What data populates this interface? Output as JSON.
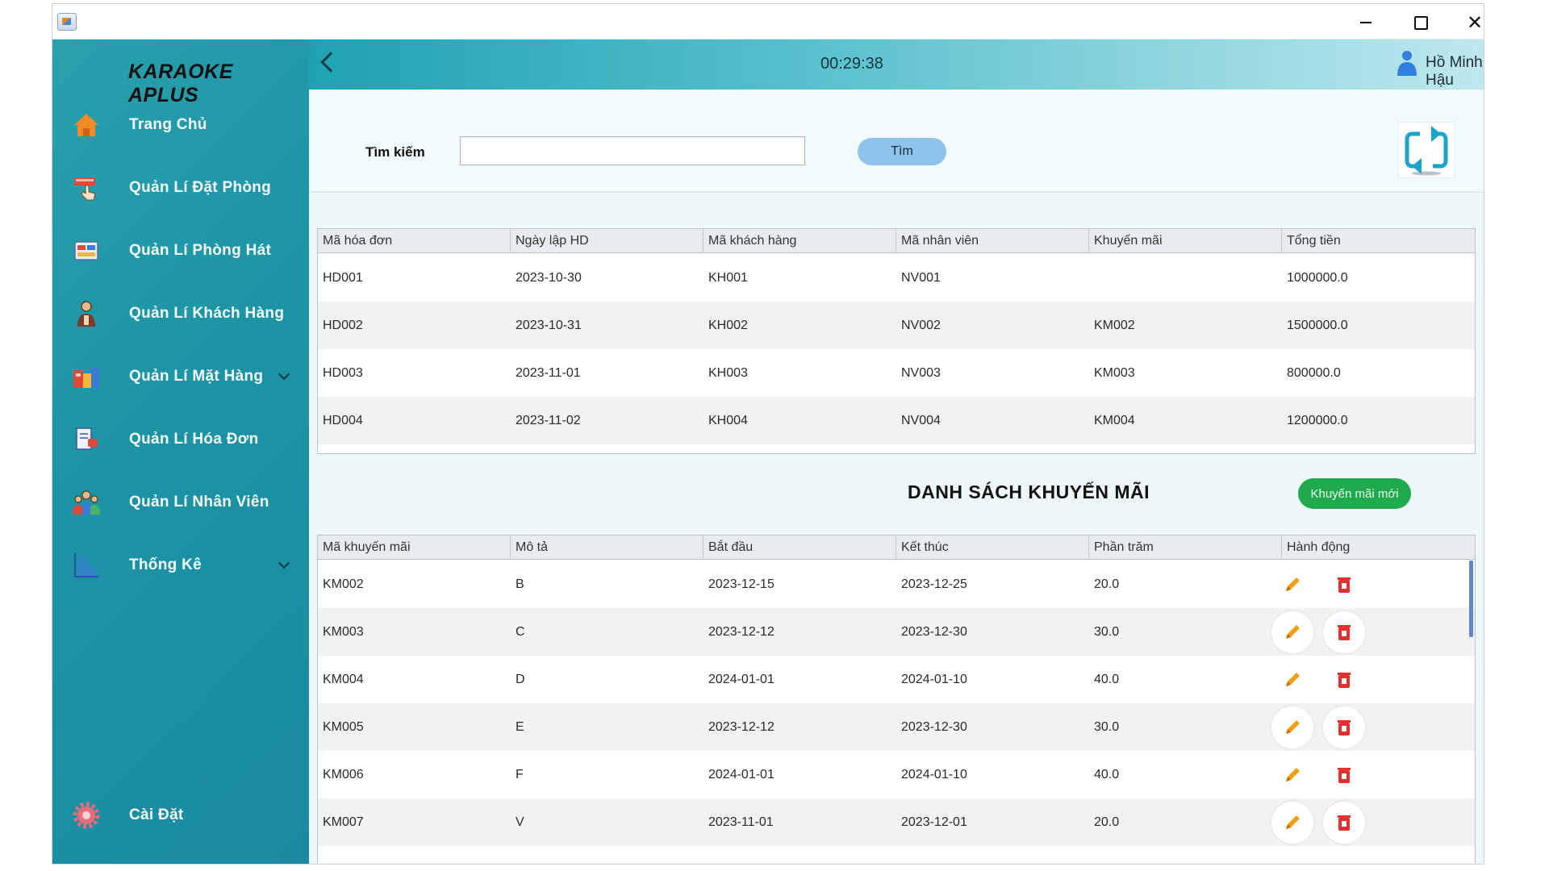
{
  "app": {
    "brand": "KARAOKE APLUS",
    "clock": "00:29:38",
    "user": "Hồ Minh Hậu"
  },
  "sidebar": {
    "items": [
      {
        "label": "Trang Chủ",
        "icon": "home-icon"
      },
      {
        "label": "Quản Lí Đặt Phòng",
        "icon": "booking-icon"
      },
      {
        "label": "Quản Lí Phòng Hát",
        "icon": "room-icon"
      },
      {
        "label": "Quản Lí Khách Hàng",
        "icon": "customer-icon"
      },
      {
        "label": "Quản Lí Mặt Hàng",
        "icon": "goods-icon"
      },
      {
        "label": "Quản Lí Hóa Đơn",
        "icon": "invoice-icon"
      },
      {
        "label": "Quản Lí Nhân Viên",
        "icon": "staff-icon"
      },
      {
        "label": "Thống Kê",
        "icon": "chart-icon"
      }
    ],
    "settings": {
      "label": "Cài Đặt",
      "icon": "settings-icon"
    }
  },
  "search": {
    "label": "Tìm kiếm",
    "value": "",
    "button": "Tìm"
  },
  "invoices": {
    "columns": [
      "Mã hóa đơn",
      "Ngày lập HD",
      "Mã khách hàng",
      "Mã nhân viên",
      "Khuyến mãi",
      "Tổng tiền"
    ],
    "rows": [
      [
        "HD001",
        "2023-10-30",
        "KH001",
        "NV001",
        "",
        "1000000.0"
      ],
      [
        "HD002",
        "2023-10-31",
        "KH002",
        "NV002",
        "KM002",
        "1500000.0"
      ],
      [
        "HD003",
        "2023-11-01",
        "KH003",
        "NV003",
        "KM003",
        "800000.0"
      ],
      [
        "HD004",
        "2023-11-02",
        "KH004",
        "NV004",
        "KM004",
        "1200000.0"
      ]
    ]
  },
  "promotions": {
    "title": "DANH SÁCH KHUYẾN MÃI",
    "new_button": "Khuyến mãi mới",
    "columns": [
      "Mã khuyến mãi",
      "Mô tả",
      "Bắt đầu",
      "Kết thúc",
      "Phần trăm",
      "Hành động"
    ],
    "rows": [
      [
        "KM002",
        "B",
        "2023-12-15",
        "2023-12-25",
        "20.0"
      ],
      [
        "KM003",
        "C",
        "2023-12-12",
        "2023-12-30",
        "30.0"
      ],
      [
        "KM004",
        "D",
        "2024-01-01",
        "2024-01-10",
        "40.0"
      ],
      [
        "KM005",
        "E",
        "2023-12-12",
        "2023-12-30",
        "30.0"
      ],
      [
        "KM006",
        "F",
        "2024-01-01",
        "2024-01-10",
        "40.0"
      ],
      [
        "KM007",
        "V",
        "2023-11-01",
        "2023-12-01",
        "20.0"
      ]
    ]
  },
  "colors": {
    "accent": "#1b9aa8",
    "new_button": "#1fab4d",
    "search_button": "#8fc3ec",
    "edit": "#f0a014",
    "delete": "#e53030"
  }
}
